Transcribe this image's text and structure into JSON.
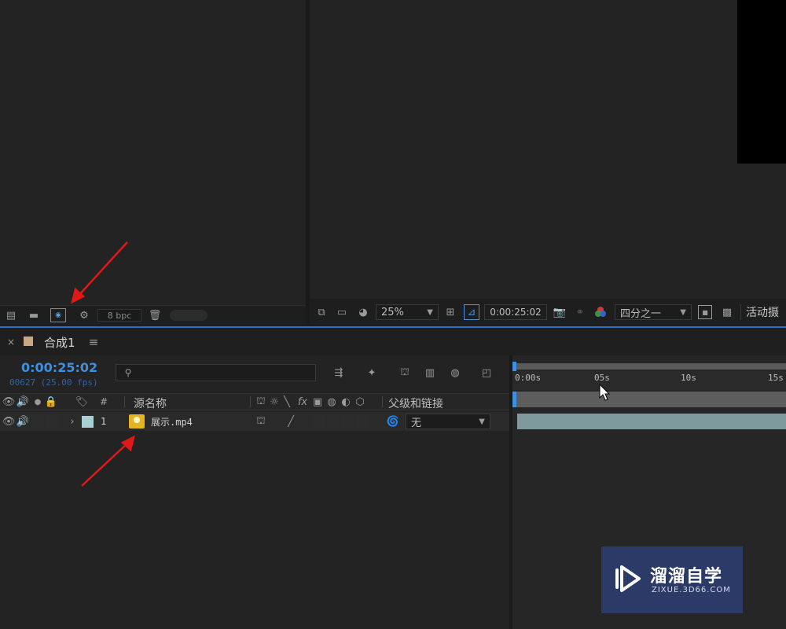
{
  "project": {
    "bpc_label": "8 bpc"
  },
  "viewer": {
    "zoom": "25%",
    "timecode": "0:00:25:02",
    "resolution": "四分之一",
    "camera": "活动摄"
  },
  "composition": {
    "tab_label": "合成1",
    "current_time": "0:00:25:02",
    "frame_info": "00627 (25.00 fps)",
    "search_placeholder": ""
  },
  "layer_columns": {
    "number_header": "#",
    "source_name_header": "源名称",
    "parent_header": "父级和链接"
  },
  "layers": [
    {
      "number": "1",
      "name": "展示.mp4",
      "parent": "无",
      "label_color": "#a9d0d4"
    }
  ],
  "ruler": {
    "ticks": [
      "0:00s",
      "05s",
      "10s",
      "15s"
    ]
  },
  "watermark": {
    "brand": "溜溜自学",
    "url": "ZIXUE.3D66.COM"
  },
  "colors": {
    "accent_blue": "#2d6fc0",
    "timecode_blue": "#3d8fe0",
    "layer_bar": "#7e9a9c",
    "label_square": "#c7a988",
    "annotation_red": "#e01818",
    "watermark_bg": "#2b3a66"
  }
}
